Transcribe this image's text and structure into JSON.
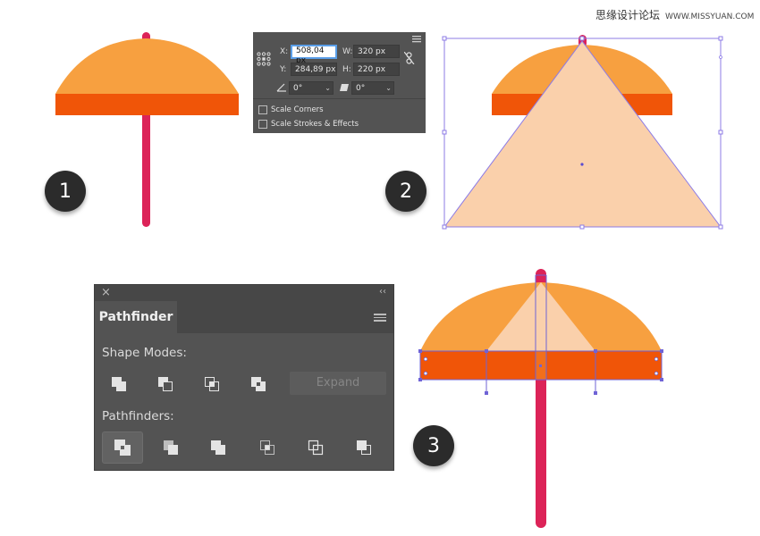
{
  "watermark": {
    "text": "思缘设计论坛",
    "site": "WWW.MISSYUAN.COM"
  },
  "steps": [
    "1",
    "2",
    "3"
  ],
  "colors": {
    "umbrella_top": "#F7A040",
    "umbrella_band": "#F05508",
    "pole": "#DC2358",
    "triangle": "#FAD0AB",
    "selection": "#8C7BE6",
    "panel": "#535353"
  },
  "transform_panel": {
    "x_label": "X:",
    "x_value": "508,04 px",
    "y_label": "Y:",
    "y_value": "284,89 px",
    "w_label": "W:",
    "w_value": "320 px",
    "h_label": "H:",
    "h_value": "220 px",
    "rotate_value": "0°",
    "shear_value": "0°",
    "scale_corners": "Scale Corners",
    "scale_strokes": "Scale Strokes & Effects",
    "icons": [
      "reference-point-icon",
      "constrain-link-icon",
      "rotate-icon",
      "shear-icon",
      "panel-menu-icon"
    ]
  },
  "pathfinder_panel": {
    "tab": "Pathfinder",
    "shape_modes_label": "Shape Modes:",
    "pathfinders_label": "Pathfinders:",
    "expand_label": "Expand",
    "shape_modes": [
      "unite",
      "minus-front",
      "intersect",
      "exclude"
    ],
    "pathfinders": [
      "divide",
      "trim",
      "merge",
      "crop",
      "outline",
      "minus-back"
    ],
    "selected_pathfinder": "divide"
  }
}
